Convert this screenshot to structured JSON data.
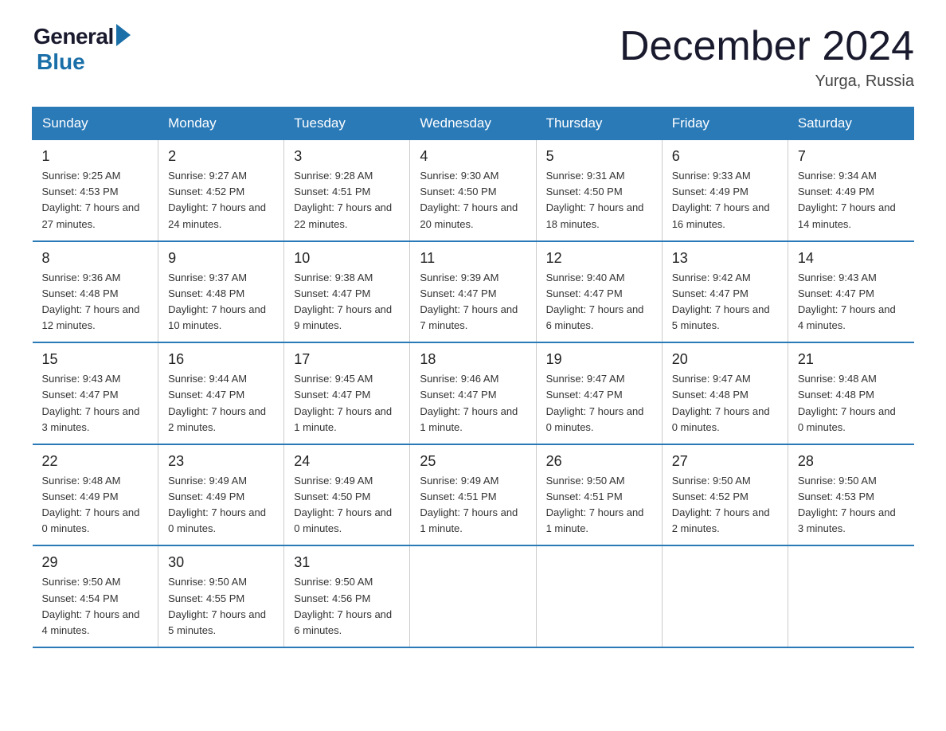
{
  "header": {
    "logo_general": "General",
    "logo_blue": "Blue",
    "month_title": "December 2024",
    "location": "Yurga, Russia"
  },
  "weekdays": [
    "Sunday",
    "Monday",
    "Tuesday",
    "Wednesday",
    "Thursday",
    "Friday",
    "Saturday"
  ],
  "weeks": [
    [
      {
        "day": "1",
        "sunrise": "9:25 AM",
        "sunset": "4:53 PM",
        "daylight": "7 hours and 27 minutes."
      },
      {
        "day": "2",
        "sunrise": "9:27 AM",
        "sunset": "4:52 PM",
        "daylight": "7 hours and 24 minutes."
      },
      {
        "day": "3",
        "sunrise": "9:28 AM",
        "sunset": "4:51 PM",
        "daylight": "7 hours and 22 minutes."
      },
      {
        "day": "4",
        "sunrise": "9:30 AM",
        "sunset": "4:50 PM",
        "daylight": "7 hours and 20 minutes."
      },
      {
        "day": "5",
        "sunrise": "9:31 AM",
        "sunset": "4:50 PM",
        "daylight": "7 hours and 18 minutes."
      },
      {
        "day": "6",
        "sunrise": "9:33 AM",
        "sunset": "4:49 PM",
        "daylight": "7 hours and 16 minutes."
      },
      {
        "day": "7",
        "sunrise": "9:34 AM",
        "sunset": "4:49 PM",
        "daylight": "7 hours and 14 minutes."
      }
    ],
    [
      {
        "day": "8",
        "sunrise": "9:36 AM",
        "sunset": "4:48 PM",
        "daylight": "7 hours and 12 minutes."
      },
      {
        "day": "9",
        "sunrise": "9:37 AM",
        "sunset": "4:48 PM",
        "daylight": "7 hours and 10 minutes."
      },
      {
        "day": "10",
        "sunrise": "9:38 AM",
        "sunset": "4:47 PM",
        "daylight": "7 hours and 9 minutes."
      },
      {
        "day": "11",
        "sunrise": "9:39 AM",
        "sunset": "4:47 PM",
        "daylight": "7 hours and 7 minutes."
      },
      {
        "day": "12",
        "sunrise": "9:40 AM",
        "sunset": "4:47 PM",
        "daylight": "7 hours and 6 minutes."
      },
      {
        "day": "13",
        "sunrise": "9:42 AM",
        "sunset": "4:47 PM",
        "daylight": "7 hours and 5 minutes."
      },
      {
        "day": "14",
        "sunrise": "9:43 AM",
        "sunset": "4:47 PM",
        "daylight": "7 hours and 4 minutes."
      }
    ],
    [
      {
        "day": "15",
        "sunrise": "9:43 AM",
        "sunset": "4:47 PM",
        "daylight": "7 hours and 3 minutes."
      },
      {
        "day": "16",
        "sunrise": "9:44 AM",
        "sunset": "4:47 PM",
        "daylight": "7 hours and 2 minutes."
      },
      {
        "day": "17",
        "sunrise": "9:45 AM",
        "sunset": "4:47 PM",
        "daylight": "7 hours and 1 minute."
      },
      {
        "day": "18",
        "sunrise": "9:46 AM",
        "sunset": "4:47 PM",
        "daylight": "7 hours and 1 minute."
      },
      {
        "day": "19",
        "sunrise": "9:47 AM",
        "sunset": "4:47 PM",
        "daylight": "7 hours and 0 minutes."
      },
      {
        "day": "20",
        "sunrise": "9:47 AM",
        "sunset": "4:48 PM",
        "daylight": "7 hours and 0 minutes."
      },
      {
        "day": "21",
        "sunrise": "9:48 AM",
        "sunset": "4:48 PM",
        "daylight": "7 hours and 0 minutes."
      }
    ],
    [
      {
        "day": "22",
        "sunrise": "9:48 AM",
        "sunset": "4:49 PM",
        "daylight": "7 hours and 0 minutes."
      },
      {
        "day": "23",
        "sunrise": "9:49 AM",
        "sunset": "4:49 PM",
        "daylight": "7 hours and 0 minutes."
      },
      {
        "day": "24",
        "sunrise": "9:49 AM",
        "sunset": "4:50 PM",
        "daylight": "7 hours and 0 minutes."
      },
      {
        "day": "25",
        "sunrise": "9:49 AM",
        "sunset": "4:51 PM",
        "daylight": "7 hours and 1 minute."
      },
      {
        "day": "26",
        "sunrise": "9:50 AM",
        "sunset": "4:51 PM",
        "daylight": "7 hours and 1 minute."
      },
      {
        "day": "27",
        "sunrise": "9:50 AM",
        "sunset": "4:52 PM",
        "daylight": "7 hours and 2 minutes."
      },
      {
        "day": "28",
        "sunrise": "9:50 AM",
        "sunset": "4:53 PM",
        "daylight": "7 hours and 3 minutes."
      }
    ],
    [
      {
        "day": "29",
        "sunrise": "9:50 AM",
        "sunset": "4:54 PM",
        "daylight": "7 hours and 4 minutes."
      },
      {
        "day": "30",
        "sunrise": "9:50 AM",
        "sunset": "4:55 PM",
        "daylight": "7 hours and 5 minutes."
      },
      {
        "day": "31",
        "sunrise": "9:50 AM",
        "sunset": "4:56 PM",
        "daylight": "7 hours and 6 minutes."
      },
      null,
      null,
      null,
      null
    ]
  ],
  "labels": {
    "sunrise": "Sunrise:",
    "sunset": "Sunset:",
    "daylight": "Daylight:"
  }
}
